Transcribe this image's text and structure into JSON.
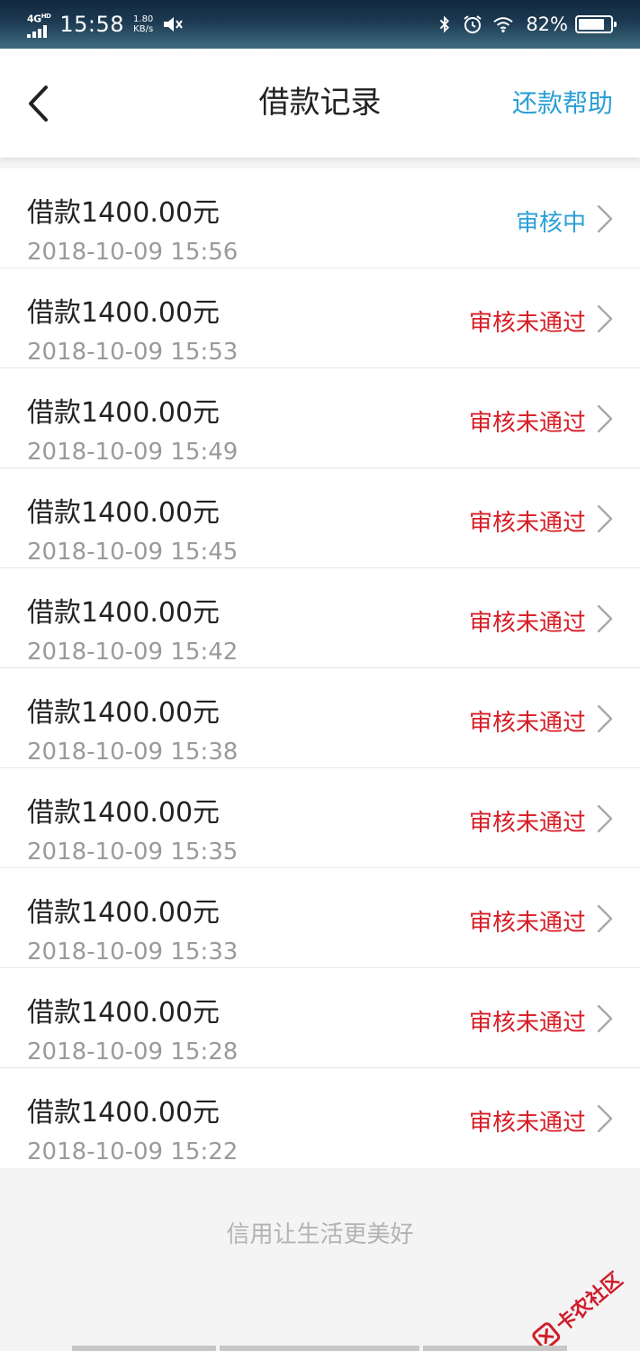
{
  "status_bar": {
    "network": "4G",
    "network_sup": "HD",
    "time": "15:58",
    "speed_value": "1.80",
    "speed_unit": "KB/s",
    "battery_percent": "82%",
    "battery_level": 0.82,
    "icons": [
      "signal-icon",
      "mute-icon",
      "bluetooth-icon",
      "alarm-icon",
      "wifi-icon",
      "battery-icon"
    ]
  },
  "navbar": {
    "back_icon": "back-arrow-icon",
    "title": "借款记录",
    "help_link": "还款帮助"
  },
  "records": [
    {
      "amount": "借款1400.00元",
      "time": "2018-10-09 15:56",
      "status": "审核中",
      "status_type": "pending"
    },
    {
      "amount": "借款1400.00元",
      "time": "2018-10-09 15:53",
      "status": "审核未通过",
      "status_type": "rejected"
    },
    {
      "amount": "借款1400.00元",
      "time": "2018-10-09 15:49",
      "status": "审核未通过",
      "status_type": "rejected"
    },
    {
      "amount": "借款1400.00元",
      "time": "2018-10-09 15:45",
      "status": "审核未通过",
      "status_type": "rejected"
    },
    {
      "amount": "借款1400.00元",
      "time": "2018-10-09 15:42",
      "status": "审核未通过",
      "status_type": "rejected"
    },
    {
      "amount": "借款1400.00元",
      "time": "2018-10-09 15:38",
      "status": "审核未通过",
      "status_type": "rejected"
    },
    {
      "amount": "借款1400.00元",
      "time": "2018-10-09 15:35",
      "status": "审核未通过",
      "status_type": "rejected"
    },
    {
      "amount": "借款1400.00元",
      "time": "2018-10-09 15:33",
      "status": "审核未通过",
      "status_type": "rejected"
    },
    {
      "amount": "借款1400.00元",
      "time": "2018-10-09 15:28",
      "status": "审核未通过",
      "status_type": "rejected"
    },
    {
      "amount": "借款1400.00元",
      "time": "2018-10-09 15:22",
      "status": "审核未通过",
      "status_type": "rejected"
    }
  ],
  "footer": {
    "slogan": "信用让生活更美好",
    "watermark": "卡农社区"
  },
  "colors": {
    "accent_blue": "#2a9fd6",
    "status_red": "#d71d26",
    "text_primary": "#222222",
    "text_secondary": "#9a9a9a"
  }
}
